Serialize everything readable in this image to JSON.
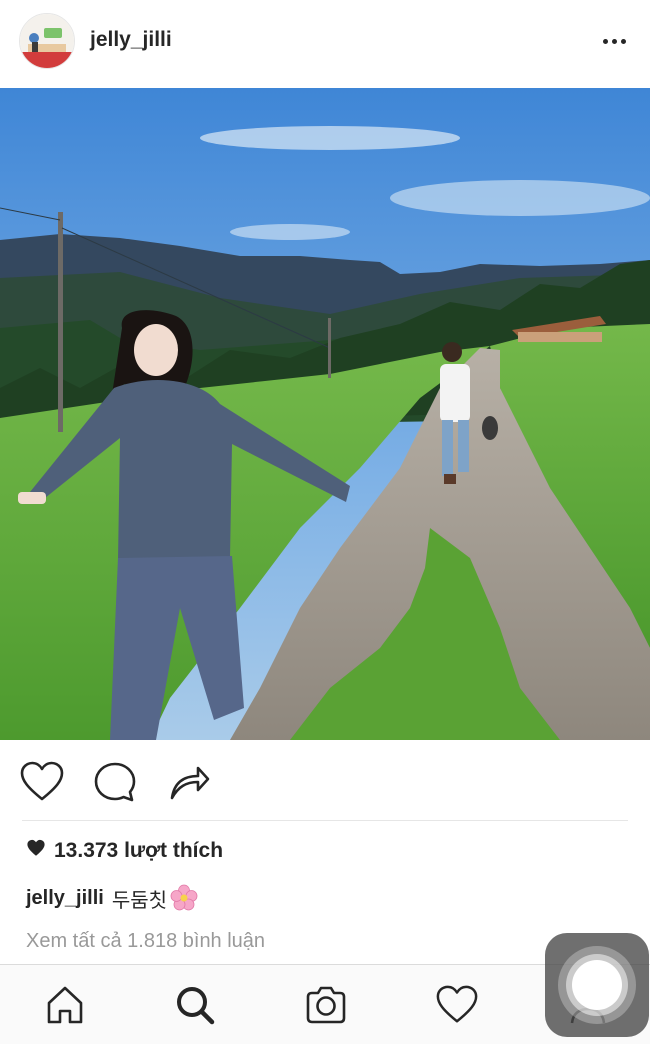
{
  "post": {
    "username": "jelly_jilli",
    "likes_text": "13.373 lượt thích",
    "caption_user": "jelly_jilli",
    "caption_text": "두둠칫",
    "caption_emoji": "flower-emoji",
    "view_comments": "Xem tất cả 1.818 bình luận"
  },
  "icons": {
    "more": "more-options-icon",
    "like": "heart-icon",
    "comment": "comment-bubble-icon",
    "share": "share-arrow-icon",
    "likes_heart": "filled-heart-icon"
  },
  "tabbar": {
    "items": [
      "home-icon",
      "search-icon",
      "camera-icon",
      "activity-heart-icon",
      "profile-icon"
    ],
    "active": "search-icon"
  },
  "colors": {
    "text": "#262626",
    "muted": "#999999",
    "divider": "#e6e6e6",
    "tabbar_bg": "#fafafa"
  }
}
